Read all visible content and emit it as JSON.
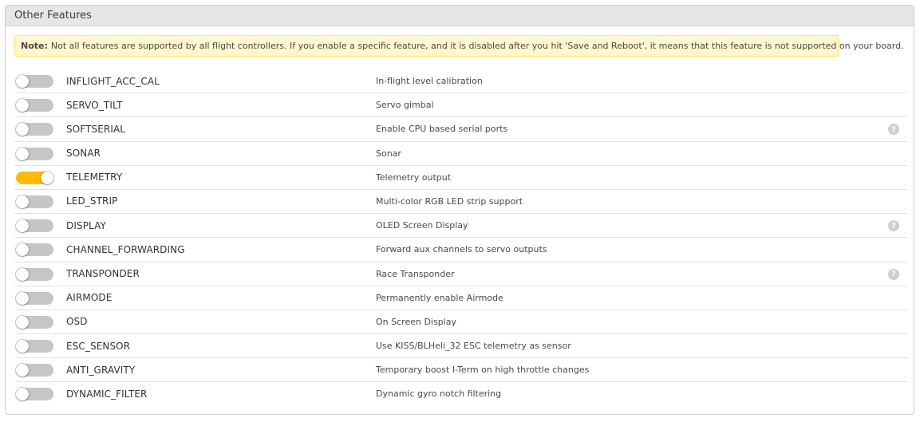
{
  "panel": {
    "title": "Other Features"
  },
  "note": {
    "label": "Note:",
    "text": "Not all features are supported by all flight controllers. If you enable a specific feature, and it is disabled after you hit 'Save and Reboot', it means that this feature is not supported on your board."
  },
  "colors": {
    "toggle_on": "#ffbb00",
    "toggle_off": "#c6c6c6",
    "note_background": "#fff7cd",
    "note_border": "#ffe55f"
  },
  "help_icon": "?",
  "features": [
    {
      "name": "INFLIGHT_ACC_CAL",
      "description": "In-flight level calibration",
      "enabled": false,
      "help": false
    },
    {
      "name": "SERVO_TILT",
      "description": "Servo gimbal",
      "enabled": false,
      "help": false
    },
    {
      "name": "SOFTSERIAL",
      "description": "Enable CPU based serial ports",
      "enabled": false,
      "help": true
    },
    {
      "name": "SONAR",
      "description": "Sonar",
      "enabled": false,
      "help": false
    },
    {
      "name": "TELEMETRY",
      "description": "Telemetry output",
      "enabled": true,
      "help": false
    },
    {
      "name": "LED_STRIP",
      "description": "Multi-color RGB LED strip support",
      "enabled": false,
      "help": false
    },
    {
      "name": "DISPLAY",
      "description": "OLED Screen Display",
      "enabled": false,
      "help": true
    },
    {
      "name": "CHANNEL_FORWARDING",
      "description": "Forward aux channels to servo outputs",
      "enabled": false,
      "help": false
    },
    {
      "name": "TRANSPONDER",
      "description": "Race Transponder",
      "enabled": false,
      "help": true
    },
    {
      "name": "AIRMODE",
      "description": "Permanently enable Airmode",
      "enabled": false,
      "help": false
    },
    {
      "name": "OSD",
      "description": "On Screen Display",
      "enabled": false,
      "help": false
    },
    {
      "name": "ESC_SENSOR",
      "description": "Use KISS/BLHeli_32 ESC telemetry as sensor",
      "enabled": false,
      "help": false
    },
    {
      "name": "ANTI_GRAVITY",
      "description": "Temporary boost I-Term on high throttle changes",
      "enabled": false,
      "help": false
    },
    {
      "name": "DYNAMIC_FILTER",
      "description": "Dynamic gyro notch filtering",
      "enabled": false,
      "help": false
    }
  ]
}
